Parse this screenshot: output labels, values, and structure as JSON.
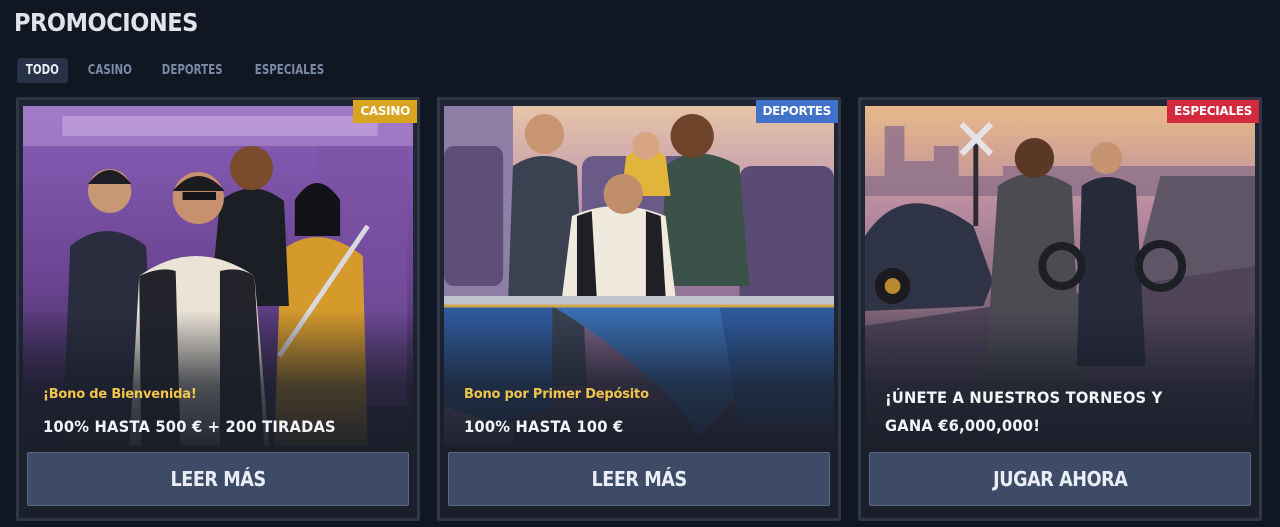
{
  "page": {
    "title": "PROMOCIONES"
  },
  "tabs": [
    {
      "label": "TODO",
      "active": true
    },
    {
      "label": "CASINO",
      "active": false
    },
    {
      "label": "DEPORTES",
      "active": false
    },
    {
      "label": "ESPECIALES",
      "active": false
    }
  ],
  "cards": [
    {
      "badge": "CASINO",
      "badge_color": "#d9a520",
      "label": "¡Bono de Bienvenida!",
      "title": "100% HASTA 500 € + 200 TIRADAS",
      "button": "LEER MÁS"
    },
    {
      "badge": "DEPORTES",
      "badge_color": "#3f72c8",
      "label": "Bono por Primer Depósito",
      "title": "100% HASTA 100 €",
      "button": "LEER MÁS"
    },
    {
      "badge": "ESPECIALES",
      "badge_color": "#d22a3c",
      "label": "",
      "title": "¡ÚNETE A NUESTROS TORNEOS Y GANA €6,000,000!",
      "button": "JUGAR AHORA"
    }
  ]
}
